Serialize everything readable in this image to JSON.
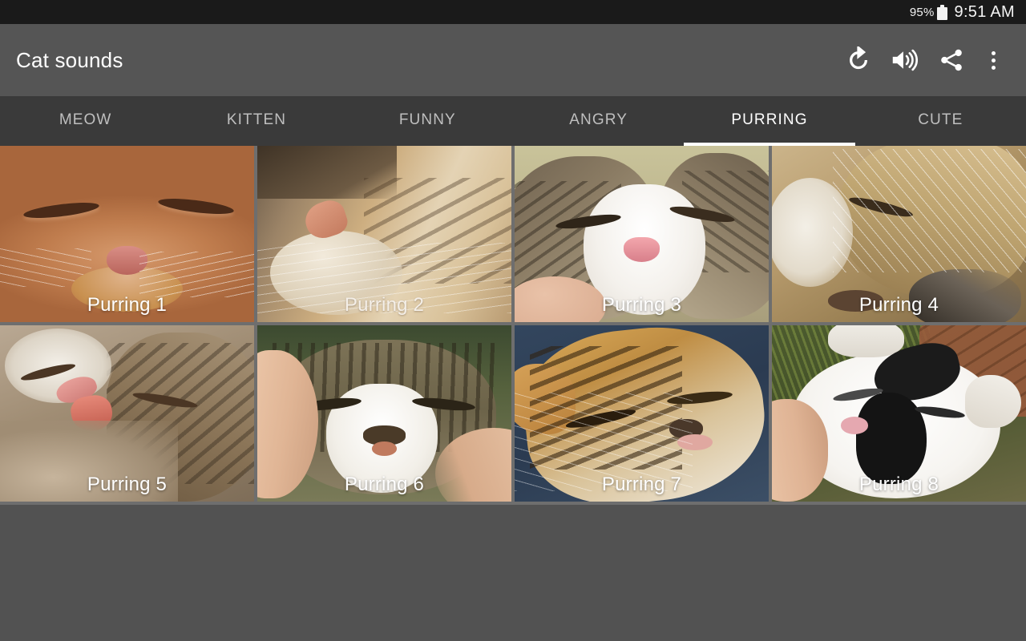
{
  "status_bar": {
    "battery_percent": "95%",
    "battery_icon": "battery-full-icon",
    "time": "9:51 AM"
  },
  "app_bar": {
    "title": "Cat sounds",
    "actions": [
      {
        "name": "refresh-icon",
        "label": "Refresh"
      },
      {
        "name": "volume-icon",
        "label": "Volume"
      },
      {
        "name": "share-icon",
        "label": "Share"
      },
      {
        "name": "overflow-menu-icon",
        "label": "More options"
      }
    ]
  },
  "tabs": {
    "active": "PURRING",
    "items": [
      {
        "label": "MEOW"
      },
      {
        "label": "KITTEN"
      },
      {
        "label": "FUNNY"
      },
      {
        "label": "ANGRY"
      },
      {
        "label": "PURRING"
      },
      {
        "label": "CUTE"
      }
    ]
  },
  "grid": {
    "items": [
      {
        "label": "Purring 1",
        "art": "orange-tabby-closed-eyes"
      },
      {
        "label": "Purring 2",
        "art": "tabby-profile-white-muzzle"
      },
      {
        "label": "Purring 3",
        "art": "tabby-white-muzzle-pink-nose"
      },
      {
        "label": "Purring 4",
        "art": "tan-tabby-whiskers"
      },
      {
        "label": "Purring 5",
        "art": "sleeping-tabby-tongue"
      },
      {
        "label": "Purring 6",
        "art": "tabby-held-by-hand"
      },
      {
        "label": "Purring 7",
        "art": "golden-kitten-blue-background"
      },
      {
        "label": "Purring 8",
        "art": "black-white-cat-on-grass"
      }
    ]
  },
  "colors": {
    "status_bar": "#1a1a1a",
    "app_bar": "#555555",
    "tab_bar": "#3a3a3a",
    "tab_active_text": "#ffffff",
    "tab_inactive_text": "#bfbfbf",
    "tab_indicator": "#ffffff",
    "page_background": "#525252",
    "grid_gap": "#6e6e6e"
  }
}
